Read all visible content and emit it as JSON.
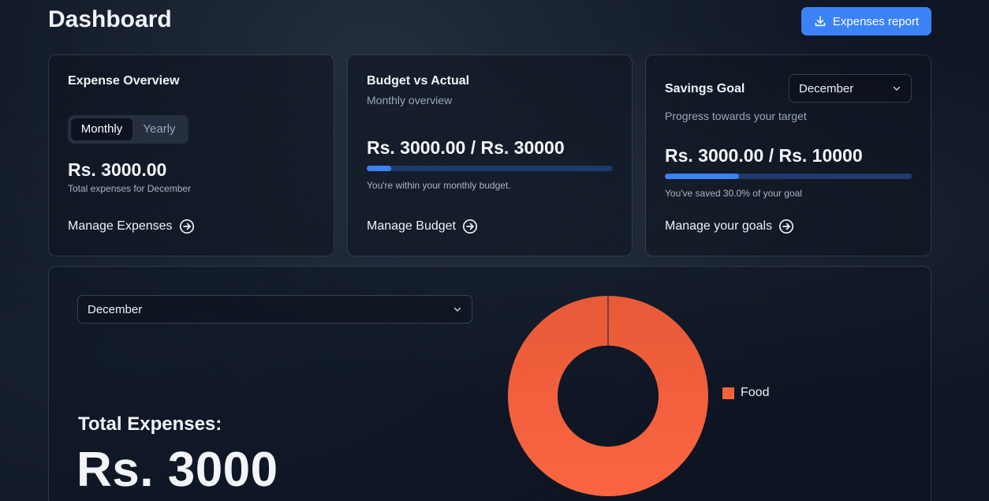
{
  "header": {
    "title": "Dashboard",
    "report_button": "Expenses report"
  },
  "expense_overview": {
    "title": "Expense Overview",
    "toggle": {
      "active": "Monthly",
      "inactive": "Yearly"
    },
    "amount": "Rs. 3000.00",
    "note": "Total expenses for December",
    "link": "Manage Expenses"
  },
  "budget": {
    "title": "Budget vs Actual",
    "subtitle": "Monthly overview",
    "amount": "Rs. 3000.00 / Rs. 30000",
    "progress": 0.1,
    "note": "You're within your monthly budget.",
    "link": "Manage Budget"
  },
  "savings": {
    "title": "Savings Goal",
    "month": "December",
    "subtitle": "Progress towards your target",
    "amount": "Rs. 3000.00 / Rs. 10000",
    "progress": 0.3,
    "note": "You've saved 30.0% of your goal",
    "link": "Manage your goals"
  },
  "chart_panel": {
    "month": "December",
    "total_label": "Total Expenses:",
    "total_value": "Rs. 3000"
  },
  "chart_data": {
    "type": "pie",
    "categories": [
      "Food"
    ],
    "values": [
      3000
    ],
    "colors": [
      "#f4623a"
    ],
    "legend": "right"
  },
  "icons": {
    "download": "download-icon",
    "arrow": "arrow-circle-right-icon",
    "chevron": "chevron-down-icon"
  },
  "colors": {
    "accent": "#3b82f6",
    "progress_track": "#1e3a6e",
    "food": "#f4623a"
  }
}
